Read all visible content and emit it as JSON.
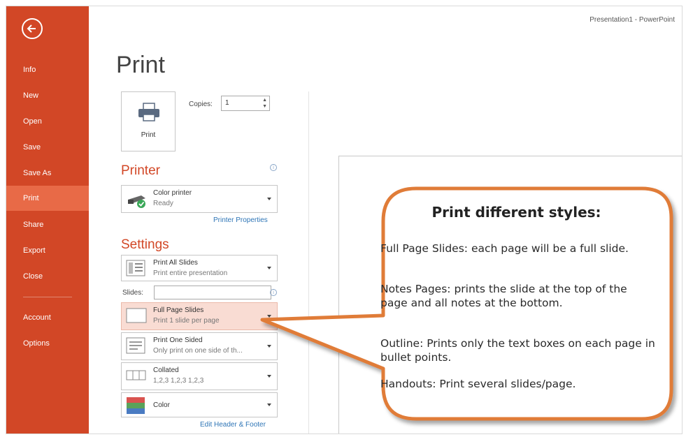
{
  "window": {
    "title": "Presentation1 - PowerPoint"
  },
  "sidebar": {
    "items": [
      {
        "label": "Info"
      },
      {
        "label": "New"
      },
      {
        "label": "Open"
      },
      {
        "label": "Save"
      },
      {
        "label": "Save As"
      },
      {
        "label": "Print"
      },
      {
        "label": "Share"
      },
      {
        "label": "Export"
      },
      {
        "label": "Close"
      },
      {
        "label": "Account"
      },
      {
        "label": "Options"
      }
    ]
  },
  "main": {
    "title": "Print",
    "print_button": {
      "label": "Print"
    },
    "copies": {
      "label": "Copies:",
      "value": "1"
    },
    "printer": {
      "heading": "Printer",
      "name": "Color printer",
      "status": "Ready",
      "properties_link": "Printer Properties"
    },
    "settings": {
      "heading": "Settings",
      "range": {
        "title": "Print All Slides",
        "subtitle": "Print entire presentation"
      },
      "slides_label": "Slides:",
      "layout": {
        "title": "Full Page Slides",
        "subtitle": "Print 1 slide per page"
      },
      "sides": {
        "title": "Print One Sided",
        "subtitle": "Only print on one side of th..."
      },
      "collation": {
        "title": "Collated",
        "subtitle": "1,2,3   1,2,3   1,2,3"
      },
      "color": {
        "title": "Color"
      },
      "header_footer_link": "Edit Header & Footer"
    }
  },
  "callout": {
    "title": "Print different styles:",
    "items": [
      {
        "term": "Full Page Slides:",
        "text": " each page will be a full slide."
      },
      {
        "term": "Notes Pages:",
        "text": " prints the slide at the top of the page and all notes at the bottom."
      },
      {
        "term": "Outline:",
        "text": " Prints only the text boxes on each page in bullet points."
      },
      {
        "term": "Handouts:",
        "text": " Print several slides/page."
      }
    ]
  },
  "colors": {
    "accent": "#d24726",
    "active_nav": "#e86a47",
    "highlight": "#f9dcd3",
    "callout_border": "#e07b39",
    "link": "#2e75b6"
  }
}
